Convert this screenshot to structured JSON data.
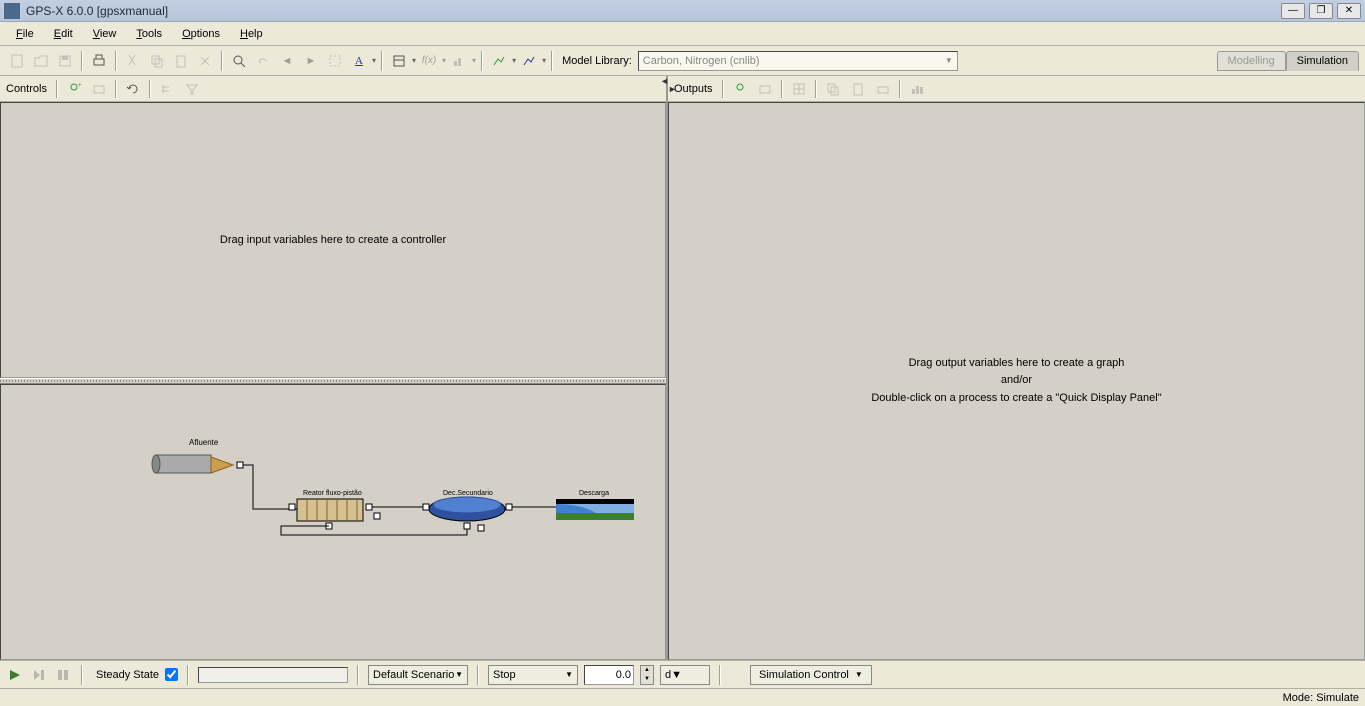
{
  "window": {
    "title": "GPS-X 6.0.0 [gpsxmanual]"
  },
  "menu": {
    "file": "File",
    "edit": "Edit",
    "view": "View",
    "tools": "Tools",
    "options": "Options",
    "help": "Help"
  },
  "toolbar": {
    "model_library_label": "Model Library:",
    "model_library_value": "Carbon, Nitrogen (cnlib)",
    "mode_modelling": "Modelling",
    "mode_simulation": "Simulation"
  },
  "panes": {
    "controls_title": "Controls",
    "controls_placeholder": "Drag input variables here to create a controller",
    "outputs_title": "Outputs",
    "outputs_line1": "Drag output variables here to create a graph",
    "outputs_line2": "and/or",
    "outputs_line3": "Double-click on a process to create a \"Quick Display Panel\""
  },
  "diagram": {
    "labels": {
      "afluente": "Afluente",
      "reator": "Reator fluxo-pistão",
      "dec": "Dec.Secundario",
      "descarga": "Descarga"
    }
  },
  "bottom": {
    "steady_state": "Steady State",
    "default_scenario": "Default Scenario",
    "stop": "Stop",
    "time_value": "0.0",
    "time_unit": "d",
    "simulation_control": "Simulation Control"
  },
  "status": {
    "mode": "Mode: Simulate"
  }
}
